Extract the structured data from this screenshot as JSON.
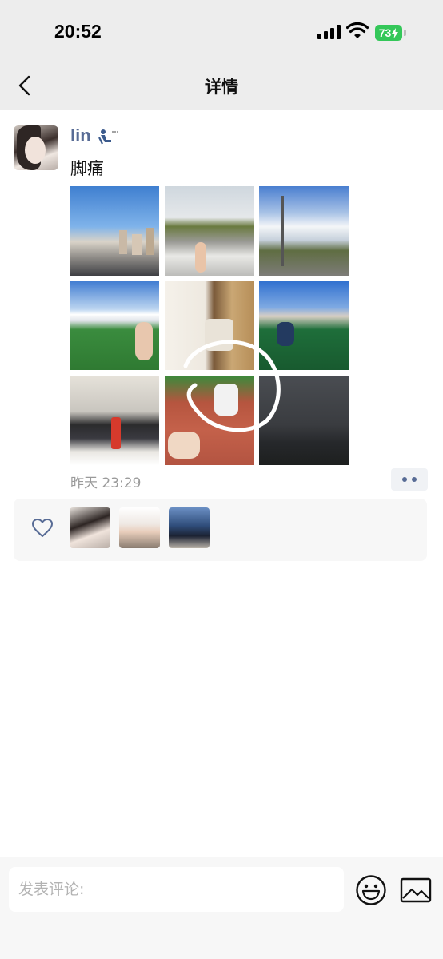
{
  "status_bar": {
    "time": "20:52",
    "battery_level": "73",
    "battery_color": "#34c759",
    "signal_icon": "cellular-signal-icon",
    "wifi_icon": "wifi-icon",
    "charging_icon": "lightning-bolt-icon"
  },
  "nav": {
    "title": "详情",
    "back_icon": "chevron-left-icon"
  },
  "post": {
    "username": "lin",
    "username_color": "#576b95",
    "badge_icon": "status-figure-icon",
    "text": "脚痛",
    "time": "昨天 23:29",
    "photos": [
      {
        "description": "sky-street-buildings"
      },
      {
        "description": "crosswalk-hand"
      },
      {
        "description": "clouds-streetlight"
      },
      {
        "description": "field-finger"
      },
      {
        "description": "cup-table"
      },
      {
        "description": "field-night-people"
      },
      {
        "description": "classroom-desk"
      },
      {
        "description": "track-shoes"
      },
      {
        "description": "dark-sky"
      }
    ],
    "more_icon": "more-dots-icon"
  },
  "likes": {
    "heart_icon": "heart-outline-icon",
    "avatars": [
      "avatar-girl-long-hair",
      "avatar-girl-white-hat",
      "avatar-girl-beach"
    ]
  },
  "comment_bar": {
    "placeholder": "发表评论:",
    "emoji_icon": "smiley-face-icon",
    "image_icon": "picture-icon"
  }
}
